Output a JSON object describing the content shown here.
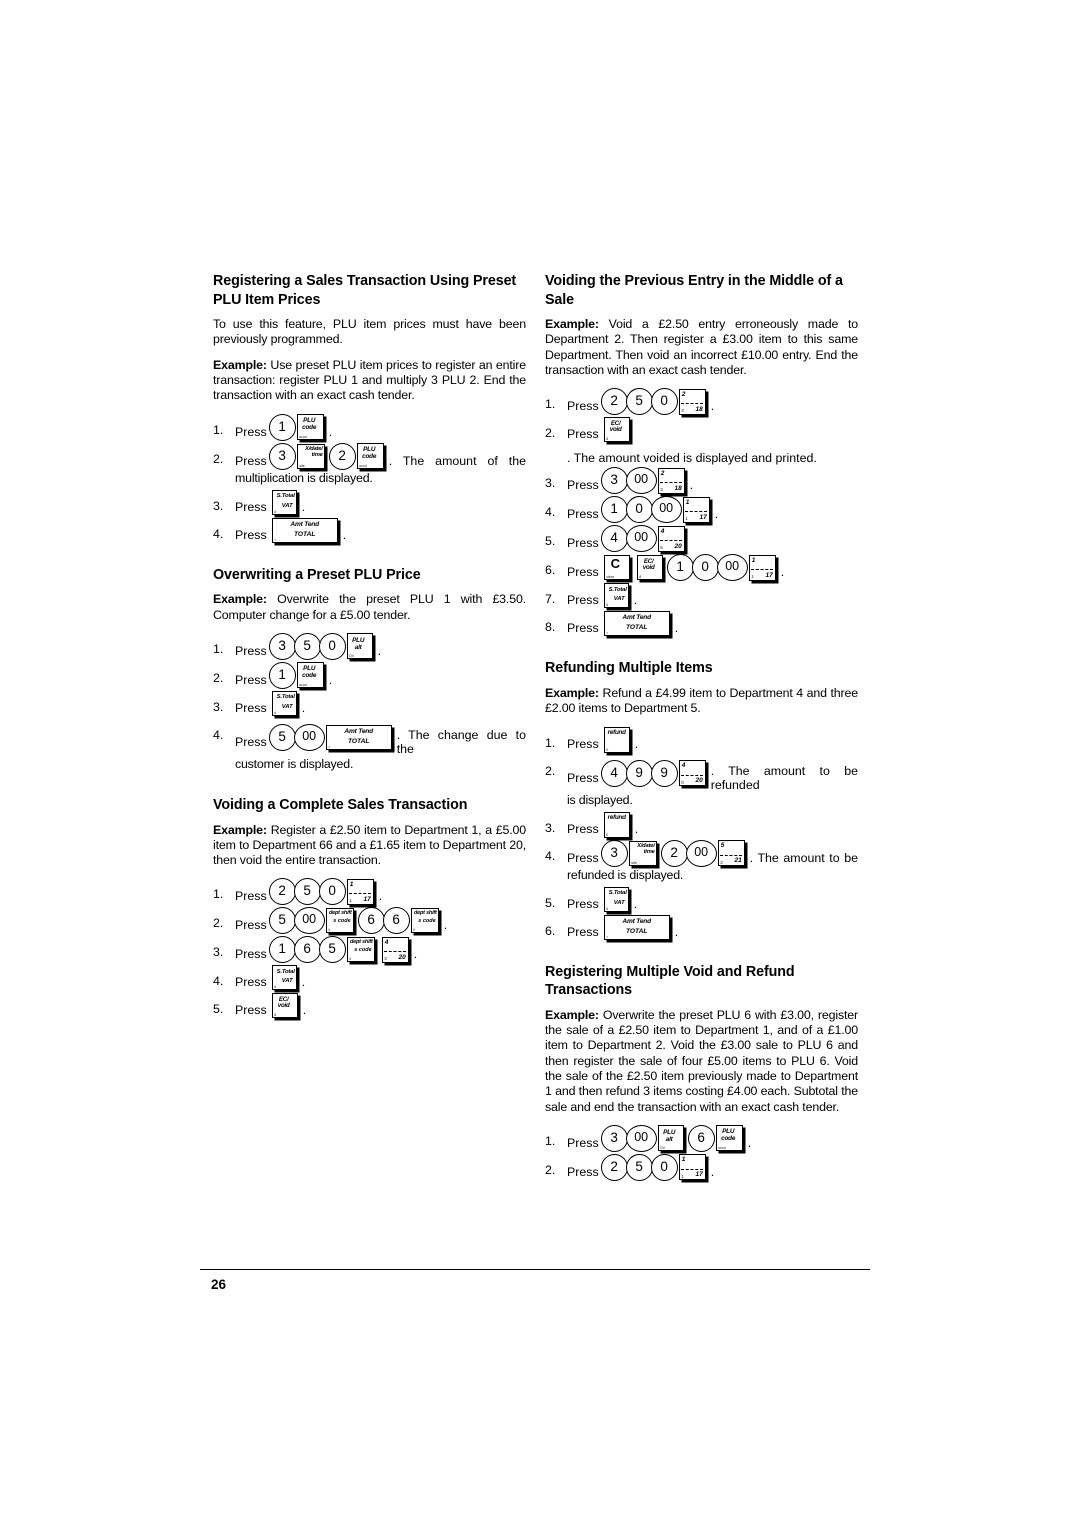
{
  "page_number": "26",
  "left_column": {
    "sections": [
      {
        "heading": "Registering a Sales Transaction Using Preset PLU Item Prices",
        "paragraphs": [
          {
            "lead": "",
            "text": "To use this feature, PLU item prices must have been previously programmed."
          },
          {
            "lead": "Example:",
            "text": " Use preset PLU item prices to register an entire transaction: register PLU 1 and multiply 3 PLU 2. End the transaction with an exact cash tender."
          }
        ],
        "steps": [
          {
            "num": "1.",
            "press": "Press",
            "keys": [
              {
                "type": "round",
                "label": "1"
              },
              {
                "type": "plu-code"
              }
            ],
            "tail": "."
          },
          {
            "num": "2.",
            "press": "Press",
            "keys": [
              {
                "type": "round",
                "label": "3"
              },
              {
                "type": "x-date-time"
              },
              {
                "type": "round",
                "label": "2"
              },
              {
                "type": "plu-code"
              }
            ],
            "tail": ". The amount of the",
            "cont": "multiplication is displayed."
          },
          {
            "num": "3.",
            "press": "Press",
            "keys": [
              {
                "type": "s-total-vat"
              }
            ],
            "tail": "."
          },
          {
            "num": "4.",
            "press": "Press",
            "keys": [
              {
                "type": "amt-tend-total"
              }
            ],
            "tail": "."
          }
        ]
      },
      {
        "heading": "Overwriting a Preset PLU Price",
        "paragraphs": [
          {
            "lead": "Example:",
            "text": " Overwrite the preset PLU 1 with £3.50. Computer change for a £5.00 tender."
          }
        ],
        "steps": [
          {
            "num": "1.",
            "press": "Press",
            "keys": [
              {
                "type": "round",
                "label": "3"
              },
              {
                "type": "round",
                "label": "5"
              },
              {
                "type": "round",
                "label": "0"
              },
              {
                "type": "plu-alt"
              }
            ],
            "tail": "."
          },
          {
            "num": "2.",
            "press": "Press",
            "keys": [
              {
                "type": "round",
                "label": "1"
              },
              {
                "type": "plu-code"
              }
            ],
            "tail": "."
          },
          {
            "num": "3.",
            "press": "Press",
            "keys": [
              {
                "type": "s-total-vat"
              }
            ],
            "tail": "."
          },
          {
            "num": "4.",
            "press": "Press",
            "keys": [
              {
                "type": "round",
                "label": "5"
              },
              {
                "type": "round-wide",
                "label": "00"
              },
              {
                "type": "amt-tend-total"
              }
            ],
            "tail": ". The change due to the",
            "cont": "customer is displayed."
          }
        ]
      },
      {
        "heading": "Voiding a Complete Sales Transaction",
        "paragraphs": [
          {
            "lead": "Example:",
            "text": " Register a £2.50 item to Department 1, a £5.00 item to Department 66 and a £1.65 item to Department 20, then void the entire transaction."
          }
        ],
        "steps": [
          {
            "num": "1.",
            "press": "Press",
            "keys": [
              {
                "type": "round",
                "label": "2"
              },
              {
                "type": "round",
                "label": "5"
              },
              {
                "type": "round",
                "label": "0"
              },
              {
                "type": "dept",
                "top": "1",
                "bottom_left": "1",
                "bottom_right": "17"
              }
            ],
            "tail": "."
          },
          {
            "num": "2.",
            "press": "Press",
            "keys": [
              {
                "type": "round",
                "label": "5"
              },
              {
                "type": "round-wide",
                "label": "00"
              },
              {
                "type": "dept-shift"
              },
              {
                "type": "round",
                "label": "6"
              },
              {
                "type": "round",
                "label": "6"
              },
              {
                "type": "dept-shift"
              }
            ],
            "tail": "."
          },
          {
            "num": "3.",
            "press": "Press",
            "keys": [
              {
                "type": "round",
                "label": "1"
              },
              {
                "type": "round",
                "label": "6"
              },
              {
                "type": "round",
                "label": "5"
              },
              {
                "type": "dept-shift"
              },
              {
                "type": "dept",
                "top": "4",
                "bottom_left": "3",
                "bottom_right": "20"
              }
            ],
            "tail": "."
          },
          {
            "num": "4.",
            "press": "Press",
            "keys": [
              {
                "type": "s-total-vat"
              }
            ],
            "tail": "."
          },
          {
            "num": "5.",
            "press": "Press",
            "keys": [
              {
                "type": "ec-void"
              }
            ],
            "tail": "."
          }
        ]
      }
    ]
  },
  "right_column": {
    "sections": [
      {
        "heading": "Voiding the Previous Entry in the Middle of a Sale",
        "paragraphs": [
          {
            "lead": "Example:",
            "text": " Void a £2.50 entry erroneously made to Department 2. Then register a £3.00 item to this same Department. Then void an incorrect £10.00 entry. End the transaction with an exact cash tender."
          }
        ],
        "steps": [
          {
            "num": "1.",
            "press": "Press",
            "keys": [
              {
                "type": "round",
                "label": "2"
              },
              {
                "type": "round",
                "label": "5"
              },
              {
                "type": "round",
                "label": "0"
              },
              {
                "type": "dept",
                "top": "2",
                "bottom_left": "3",
                "bottom_right": "18"
              }
            ],
            "tail": "."
          },
          {
            "num": "2.",
            "press": "Press",
            "keys": [
              {
                "type": "ec-void"
              }
            ],
            "tail": ". The amount voided is displayed and printed."
          },
          {
            "num": "3.",
            "press": "Press",
            "keys": [
              {
                "type": "round",
                "label": "3"
              },
              {
                "type": "round-wide",
                "label": "00"
              },
              {
                "type": "dept",
                "top": "2",
                "bottom_left": "3",
                "bottom_right": "18"
              }
            ],
            "tail": "."
          },
          {
            "num": "4.",
            "press": "Press",
            "keys": [
              {
                "type": "round",
                "label": "1"
              },
              {
                "type": "round",
                "label": "0"
              },
              {
                "type": "round-wide",
                "label": "00"
              },
              {
                "type": "dept",
                "top": "1",
                "bottom_left": "1",
                "bottom_right": "17"
              }
            ],
            "tail": "."
          },
          {
            "num": "5.",
            "press": "Press",
            "keys": [
              {
                "type": "round",
                "label": "4"
              },
              {
                "type": "round-wide",
                "label": "00"
              },
              {
                "type": "dept",
                "top": "4",
                "bottom_left": "5",
                "bottom_right": "20"
              }
            ],
            "tail": ""
          },
          {
            "num": "6.",
            "press": "Press",
            "keys": [
              {
                "type": "clear"
              },
              {
                "type": "ec-void"
              },
              {
                "type": "round",
                "label": "1"
              },
              {
                "type": "round",
                "label": "0"
              },
              {
                "type": "round-wide",
                "label": "00"
              },
              {
                "type": "dept",
                "top": "1",
                "bottom_left": "1",
                "bottom_right": "17"
              }
            ],
            "tail": "."
          },
          {
            "num": "7.",
            "press": "Press",
            "keys": [
              {
                "type": "s-total-vat"
              }
            ],
            "tail": "."
          },
          {
            "num": "8.",
            "press": "Press",
            "keys": [
              {
                "type": "amt-tend-total"
              }
            ],
            "tail": "."
          }
        ]
      },
      {
        "heading": "Refunding Multiple Items",
        "paragraphs": [
          {
            "lead": "Example:",
            "text": " Refund a £4.99 item to Department 4 and three £2.00 items to Department 5."
          }
        ],
        "steps": [
          {
            "num": "1.",
            "press": "Press",
            "keys": [
              {
                "type": "refund"
              }
            ],
            "tail": "."
          },
          {
            "num": "2.",
            "press": "Press",
            "keys": [
              {
                "type": "round",
                "label": "4"
              },
              {
                "type": "round",
                "label": "9"
              },
              {
                "type": "round",
                "label": "9"
              },
              {
                "type": "dept",
                "top": "4",
                "bottom_left": "0",
                "bottom_right": "20"
              }
            ],
            "tail": ". The amount to be refunded",
            "cont": "is displayed."
          },
          {
            "num": "3.",
            "press": "Press",
            "keys": [
              {
                "type": "refund"
              }
            ],
            "tail": "."
          },
          {
            "num": "4.",
            "press": "Press",
            "keys": [
              {
                "type": "round",
                "label": "3"
              },
              {
                "type": "x-date-time"
              },
              {
                "type": "round",
                "label": "2"
              },
              {
                "type": "round-wide",
                "label": "00"
              },
              {
                "type": "dept",
                "top": "5",
                "bottom_left": "2",
                "bottom_right": "21"
              }
            ],
            "tail": ". The amount to be",
            "cont": "refunded is displayed."
          },
          {
            "num": "5.",
            "press": "Press",
            "keys": [
              {
                "type": "s-total-vat"
              }
            ],
            "tail": "."
          },
          {
            "num": "6.",
            "press": "Press",
            "keys": [
              {
                "type": "amt-tend-total"
              }
            ],
            "tail": "."
          }
        ]
      },
      {
        "heading": "Registering Multiple Void and Refund Transactions",
        "paragraphs": [
          {
            "lead": "Example:",
            "text": " Overwrite the preset PLU 6 with £3.00, register the sale of a £2.50 item to Department 1, and of a £1.00 item to Department 2. Void the £3.00 sale to PLU 6 and then register the sale of four £5.00 items to PLU 6. Void the sale of the £2.50 item previously made to Department 1 and then refund 3 items costing £4.00 each. Subtotal the sale and end the transaction with an exact cash tender."
          }
        ],
        "steps": [
          {
            "num": "1.",
            "press": "Press",
            "keys": [
              {
                "type": "round",
                "label": "3"
              },
              {
                "type": "round-wide",
                "label": "00"
              },
              {
                "type": "plu-alt"
              },
              {
                "type": "round",
                "label": "6"
              },
              {
                "type": "plu-code"
              }
            ],
            "tail": "."
          },
          {
            "num": "2.",
            "press": "Press",
            "keys": [
              {
                "type": "round",
                "label": "2"
              },
              {
                "type": "round",
                "label": "5"
              },
              {
                "type": "round",
                "label": "0"
              },
              {
                "type": "dept",
                "top": "1",
                "bottom_left": "1",
                "bottom_right": "17"
              }
            ],
            "tail": "."
          }
        ]
      }
    ]
  },
  "key_glyphs": {
    "plu-code": {
      "line1": "PLU",
      "line2": "code",
      "sub": "scod"
    },
    "plu-alt": {
      "line1": "PLU",
      "line2": "alt",
      "sub": "DV"
    },
    "x-date-time": {
      "line1": "X/date/",
      "line2": "time",
      "sub": "site"
    },
    "s-total-vat": {
      "line1": "S.Total",
      "line2": "VAT",
      "sub": "#"
    },
    "amt-tend-total": {
      "line1": "Amt Tend",
      "line2": "TOTAL",
      "sub": "="
    },
    "ec-void": {
      "line1": "EC/",
      "line2": "void",
      "sub": "8"
    },
    "clear": {
      "line1": "C",
      "line2": "",
      "sub": "clear"
    },
    "refund": {
      "line1": "refund",
      "line2": "",
      "sub": "£"
    },
    "dept-shift": {
      "line1": "dept shift",
      "line2": "s code",
      "sub": "0"
    }
  }
}
